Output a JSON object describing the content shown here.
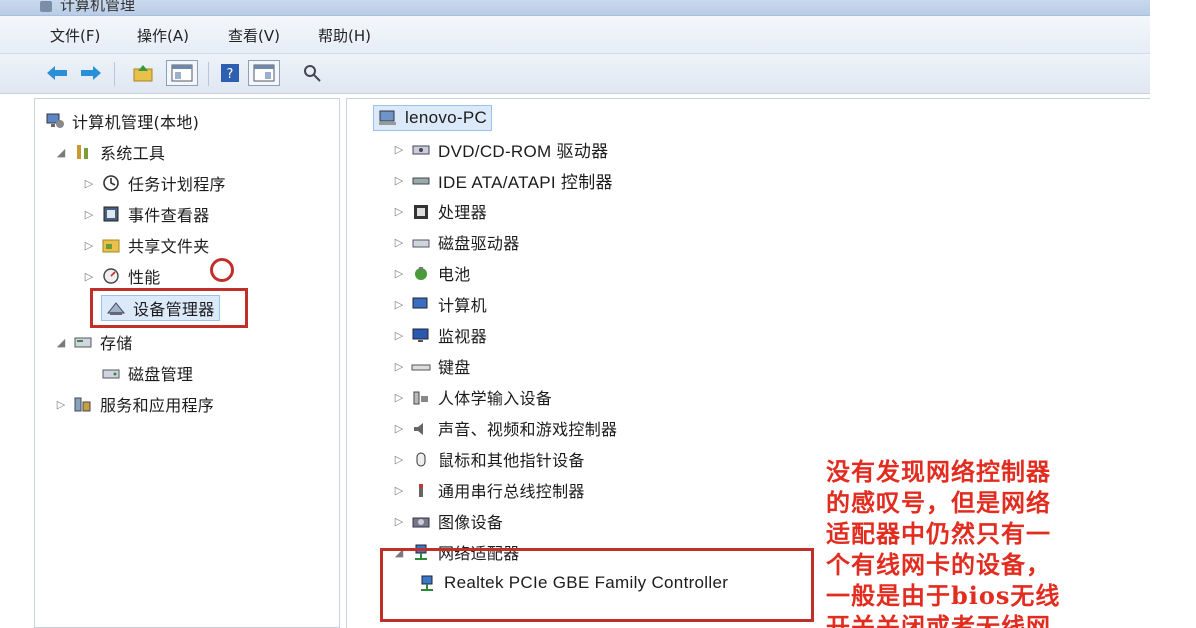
{
  "window": {
    "title": "计算机管理"
  },
  "menu": [
    "文件(F)",
    "操作(A)",
    "查看(V)",
    "帮助(H)"
  ],
  "left_tree": [
    {
      "label": "计算机管理(本地)",
      "expander": "",
      "icon": "computer-management-icon"
    },
    {
      "label": "系统工具",
      "expander": "◢",
      "icon": "system-tools-icon"
    },
    {
      "label": "任务计划程序",
      "expander": "▷",
      "icon": "task-scheduler-icon"
    },
    {
      "label": "事件查看器",
      "expander": "▷",
      "icon": "event-viewer-icon"
    },
    {
      "label": "共享文件夹",
      "expander": "▷",
      "icon": "shared-folder-icon"
    },
    {
      "label": "性能",
      "expander": "▷",
      "icon": "performance-icon"
    },
    {
      "label": "设备管理器",
      "expander": "",
      "icon": "device-manager-icon"
    },
    {
      "label": "存储",
      "expander": "◢",
      "icon": "storage-icon"
    },
    {
      "label": "磁盘管理",
      "expander": "",
      "icon": "disk-management-icon"
    },
    {
      "label": "服务和应用程序",
      "expander": "▷",
      "icon": "services-icon"
    }
  ],
  "right_tree": {
    "root": {
      "label": "lenovo-PC",
      "icon": "computer-icon"
    },
    "items": [
      {
        "label": "DVD/CD-ROM 驱动器",
        "icon": "dvd-drive-icon"
      },
      {
        "label": "IDE ATA/ATAPI 控制器",
        "icon": "ide-controller-icon"
      },
      {
        "label": "处理器",
        "icon": "processor-icon"
      },
      {
        "label": "磁盘驱动器",
        "icon": "disk-drive-icon"
      },
      {
        "label": "电池",
        "icon": "battery-icon"
      },
      {
        "label": "计算机",
        "icon": "computer-icon"
      },
      {
        "label": "监视器",
        "icon": "monitor-icon"
      },
      {
        "label": "键盘",
        "icon": "keyboard-icon"
      },
      {
        "label": "人体学输入设备",
        "icon": "hid-icon"
      },
      {
        "label": "声音、视频和游戏控制器",
        "icon": "sound-icon"
      },
      {
        "label": "鼠标和其他指针设备",
        "icon": "mouse-icon"
      },
      {
        "label": "通用串行总线控制器",
        "icon": "usb-icon"
      },
      {
        "label": "图像设备",
        "icon": "imaging-device-icon"
      },
      {
        "label": "网络适配器",
        "icon": "network-adapter-icon"
      },
      {
        "label": "Realtek PCIe GBE Family Controller",
        "icon": "network-adapter-icon"
      }
    ]
  },
  "note_lines": [
    "没有发现网络控制器",
    "的感叹号，但是网络",
    "适配器中仍然只有一",
    "个有线网卡的设备，",
    "一般是由于bios无线",
    "开关关闭或者无线网"
  ],
  "colors": {
    "highlight": "#c0302b",
    "note_text": "#e22c20",
    "selection": "#dbe9f9"
  }
}
